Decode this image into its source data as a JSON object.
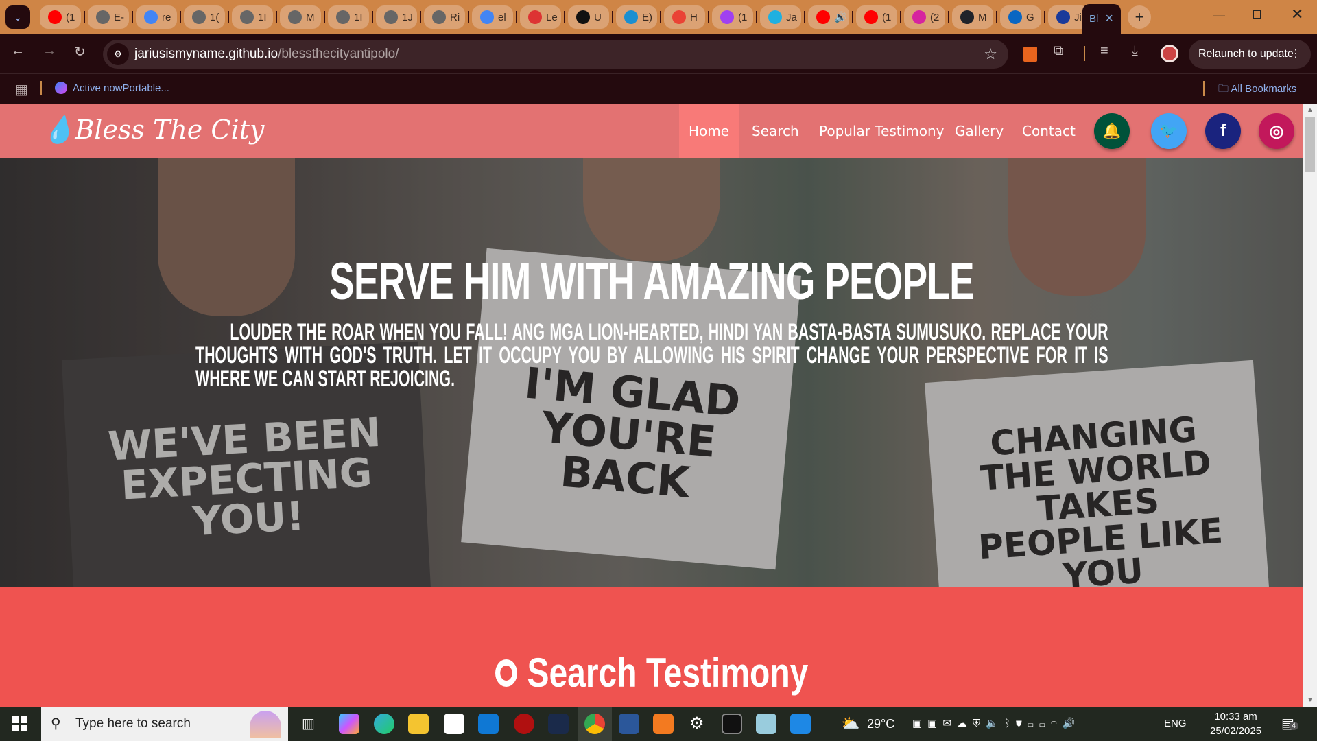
{
  "browser": {
    "tabs": [
      {
        "label": "(1",
        "icon": "youtube-icon",
        "color": "#ff0000"
      },
      {
        "label": "E-",
        "icon": "globe-icon",
        "color": "#666"
      },
      {
        "label": "re",
        "icon": "google-icon",
        "color": "#4285f4"
      },
      {
        "label": "1(",
        "icon": "globe-icon",
        "color": "#666"
      },
      {
        "label": "1I",
        "icon": "globe-icon",
        "color": "#666"
      },
      {
        "label": "M",
        "icon": "globe-icon",
        "color": "#666"
      },
      {
        "label": "1I",
        "icon": "globe-icon",
        "color": "#666"
      },
      {
        "label": "1J",
        "icon": "globe-icon",
        "color": "#666"
      },
      {
        "label": "Ri",
        "icon": "globe-icon",
        "color": "#666"
      },
      {
        "label": "el",
        "icon": "google-icon",
        "color": "#4285f4"
      },
      {
        "label": "Le",
        "icon": "app-icon",
        "color": "#d33"
      },
      {
        "label": "U",
        "icon": "openai-icon",
        "color": "#111"
      },
      {
        "label": "E)",
        "icon": "philstar-icon",
        "color": "#1a8fd0"
      },
      {
        "label": "H",
        "icon": "gmail-icon",
        "color": "#ea4335"
      },
      {
        "label": "(1",
        "icon": "messenger-icon",
        "color": "#a040f0"
      },
      {
        "label": "Ja",
        "icon": "canva-icon",
        "color": "#20b0e0"
      },
      {
        "label": "🔊",
        "icon": "youtube-icon",
        "color": "#ff0000"
      },
      {
        "label": "(1",
        "icon": "youtube-icon",
        "color": "#ff0000"
      },
      {
        "label": "(2",
        "icon": "instagram-icon",
        "color": "#d6249f"
      },
      {
        "label": "M",
        "icon": "react-icon",
        "color": "#20232a"
      },
      {
        "label": "G",
        "icon": "linkedin-icon",
        "color": "#0a66c2"
      },
      {
        "label": "Ji",
        "icon": "g-icon",
        "color": "#1a3a9a"
      }
    ],
    "active_tab": {
      "label": "Bl",
      "close": "×"
    },
    "new_tab": "+",
    "url_host": "jariusismyname.github.io",
    "url_path": "/blessthecityantipolo/",
    "relaunch": "Relaunch to update",
    "bookmark_item": "Active nowPortable...",
    "all_bookmarks": "All Bookmarks"
  },
  "site": {
    "logo": "Bless The City",
    "nav": [
      "Home",
      "Search",
      "Popular Testimony",
      "Gallery",
      "Contact"
    ],
    "active_nav": "Home",
    "social": [
      {
        "icon": "bell-icon",
        "color": "#00523a",
        "glyph": "🔔"
      },
      {
        "icon": "twitter-icon",
        "color": "#42a5f5",
        "glyph": "🐦"
      },
      {
        "icon": "facebook-icon",
        "color": "#1a237e",
        "glyph": "f"
      },
      {
        "icon": "instagram-icon",
        "color": "#c2185b",
        "glyph": "◎"
      }
    ],
    "hero": {
      "title": "SERVE HIM WITH AMAZING PEOPLE",
      "text": "LOUDER THE ROAR WHEN YOU FALL! ANG MGA LION-HEARTED, HINDI YAN BASTA-BASTA SUMUSUKO. REPLACE YOUR THOUGHTS WITH GOD'S TRUTH. LET IT OCCUPY YOU BY ALLOWING HIS SPIRIT CHANGE YOUR PERSPECTIVE FOR IT IS WHERE WE CAN START REJOICING.",
      "signs": [
        "WE'VE BEEN EXPECTING YOU!",
        "I'M GLAD YOU'RE BACK",
        "CHANGING THE WORLD TAKES PEOPLE LIKE YOU"
      ]
    },
    "search_heading": "Search Testimony"
  },
  "taskbar": {
    "search_placeholder": "Type here to search",
    "weather": "29°C",
    "language": "ENG",
    "time": "10:33 am",
    "date": "25/02/2025",
    "notifications": "4"
  }
}
